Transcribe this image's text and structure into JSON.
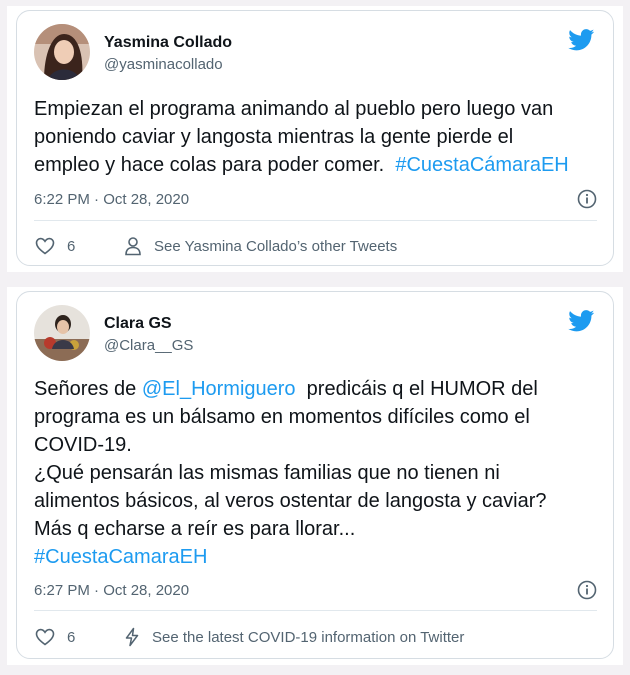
{
  "tweets": [
    {
      "author": "Yasmina Collado",
      "handle": "@yasminacollado",
      "text_lines": [
        "Empiezan el programa animando al pueblo pero luego van",
        "poniendo caviar y langosta mientras la gente pierde el",
        "empleo y hace colas para poder comer."
      ],
      "hashtag": "#CuestaCámaraEH",
      "timestamp": "6:22 PM · Oct 28, 2020",
      "like_count": "6",
      "secondary_action": "See Yasmina Collado’s other Tweets",
      "secondary_icon": "person-icon"
    },
    {
      "author": "Clara GS",
      "handle": "@Clara__GS",
      "mention": "@El_Hormiguero",
      "line1_before": "Señores de ",
      "line1_after": "  predicáis q el HUMOR del",
      "text_lines": [
        "programa es un bálsamo en momentos difíciles como el",
        "COVID-19.",
        "¿Qué pensarán las mismas familias que no tienen ni",
        "alimentos básicos, al veros ostentar de langosta y caviar?",
        "Más q echarse a reír es para llorar..."
      ],
      "hashtag": "#CuestaCamaraEH",
      "timestamp": "6:27 PM · Oct 28, 2020",
      "like_count": "6",
      "secondary_action": "See the latest COVID-19 information on Twitter",
      "secondary_icon": "lightning-icon"
    }
  ],
  "colors": {
    "link": "#1d9bf0",
    "twitter_blue": "#1d9bf0",
    "muted": "#536471",
    "text": "#0f1419",
    "page_bg": "#f3f1f4"
  }
}
